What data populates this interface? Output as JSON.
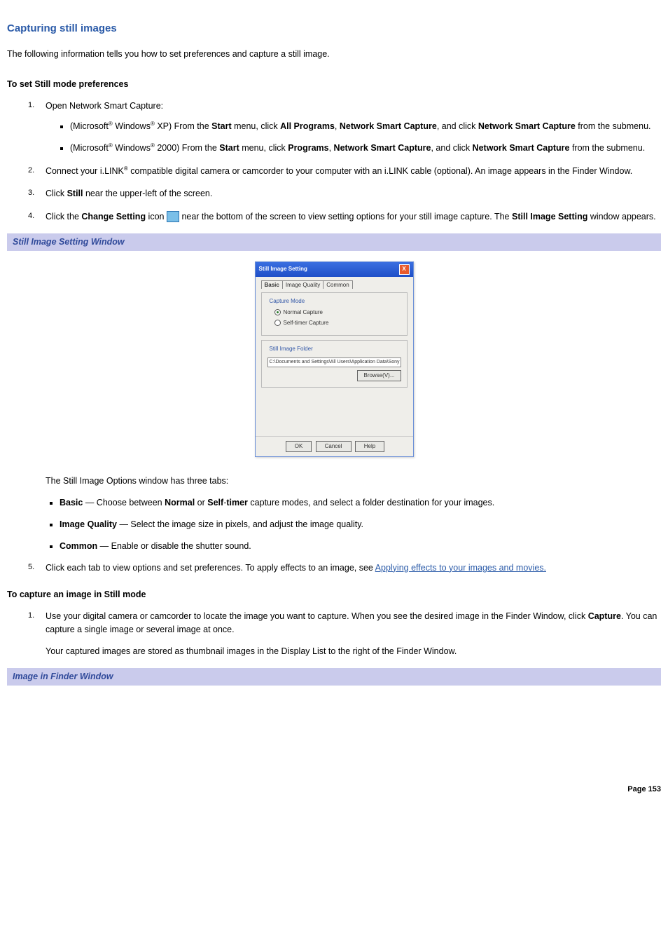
{
  "title": "Capturing still images",
  "intro": "The following information tells you how to set preferences and capture a still image.",
  "sec1": {
    "heading": "To set Still mode preferences",
    "step1": {
      "num": "1.",
      "text": "Open Network Smart Capture:",
      "bullets": {
        "xp": {
          "pre": "(Microsoft",
          "mid1": " Windows",
          "mid2": " XP) From the ",
          "b1": "Start",
          "mid3": " menu, click ",
          "b2": "All Programs",
          "mid4": ", ",
          "b3": "Network Smart Capture",
          "mid5": ", and click ",
          "b4": "Network Smart Capture",
          "mid6": " from the submenu."
        },
        "w2k": {
          "pre": "(Microsoft",
          "mid1": " Windows",
          "mid2": " 2000) From the ",
          "b1": "Start",
          "mid3": " menu, click ",
          "b2": "Programs",
          "mid4": ", ",
          "b3": "Network Smart Capture",
          "mid5": ", and click ",
          "b4": "Network Smart Capture",
          "mid6": " from the submenu."
        }
      }
    },
    "step2": {
      "num": "2.",
      "a": "Connect your i.LINK",
      "b": " compatible digital camera or camcorder to your computer with an i.LINK cable (optional). An image appears in the Finder Window."
    },
    "step3": {
      "num": "3.",
      "a": "Click ",
      "b": "Still",
      "c": " near the upper-left of the screen."
    },
    "step4": {
      "num": "4.",
      "a": "Click the ",
      "b": "Change Setting",
      "c": " icon ",
      "d": " near the bottom of the screen to view setting options for your still image capture. The ",
      "e": "Still Image Setting",
      "f": " window appears."
    },
    "figcap": "Still Image Setting Window",
    "dialog": {
      "title": "Still Image Setting",
      "tabs": {
        "t1": "Basic",
        "t2": "Image Quality",
        "t3": "Common"
      },
      "group1": {
        "title": "Capture Mode",
        "r1": "Normal Capture",
        "r2": "Self-timer Capture"
      },
      "group2": {
        "title": "Still Image Folder",
        "path": "C:\\Documents and Settings\\All Users\\Application Data\\Sony",
        "browse": "Browse(V)..."
      },
      "btns": {
        "ok": "OK",
        "cancel": "Cancel",
        "help": "Help"
      }
    },
    "afterfig": "The Still Image Options window has three tabs:",
    "tabs": {
      "basic": {
        "name": "Basic",
        "desc": " — Choose between ",
        "b1": "Normal",
        "mid": " or ",
        "b2": "Self",
        "b3": "timer",
        "tail": " capture modes, and select a folder destination for your images."
      },
      "iq": {
        "name": "Image Quality",
        "desc": " — Select the image size in pixels, and adjust the image quality."
      },
      "common": {
        "name": "Common",
        "desc": " — Enable or disable the shutter sound."
      }
    },
    "step5": {
      "num": "5.",
      "a": "Click each tab to view options and set preferences. To apply effects to an image, see ",
      "link": "Applying effects to your images and movies."
    }
  },
  "sec2": {
    "heading": "To capture an image in Still mode",
    "step1": {
      "num": "1.",
      "a": "Use your digital camera or camcorder to locate the image you want to capture. When you see the desired image in the Finder Window, click ",
      "b": "Capture",
      "c": ". You can capture a single image or several image at once.",
      "para2": "Your captured images are stored as thumbnail images in the Display List to the right of the Finder Window."
    },
    "figcap": "Image in Finder Window"
  },
  "pagenum": "Page 153",
  "reg": "®"
}
